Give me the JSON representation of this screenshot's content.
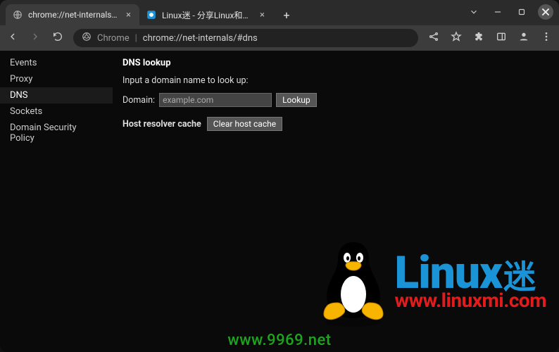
{
  "tabs": [
    {
      "title": "chrome://net-internals/#",
      "active": true
    },
    {
      "title": "Linux迷 - 分享Linux和编程",
      "active": false
    }
  ],
  "omnibox": {
    "scheme_label": "Chrome",
    "url": "chrome://net-internals/#dns"
  },
  "sidebar": {
    "items": [
      "Events",
      "Proxy",
      "DNS",
      "Sockets",
      "Domain Security Policy"
    ],
    "active_index": 2
  },
  "main": {
    "section_title": "DNS lookup",
    "instruction": "Input a domain name to look up:",
    "domain_label": "Domain:",
    "domain_placeholder": "example.com",
    "lookup_btn": "Lookup",
    "cache_label": "Host resolver cache",
    "clear_btn": "Clear host cache"
  },
  "watermark": {
    "title_main": "Linux",
    "title_suffix": "迷",
    "url": "www.linuxmi.com"
  },
  "footer": {
    "url": "www.9969.net"
  }
}
